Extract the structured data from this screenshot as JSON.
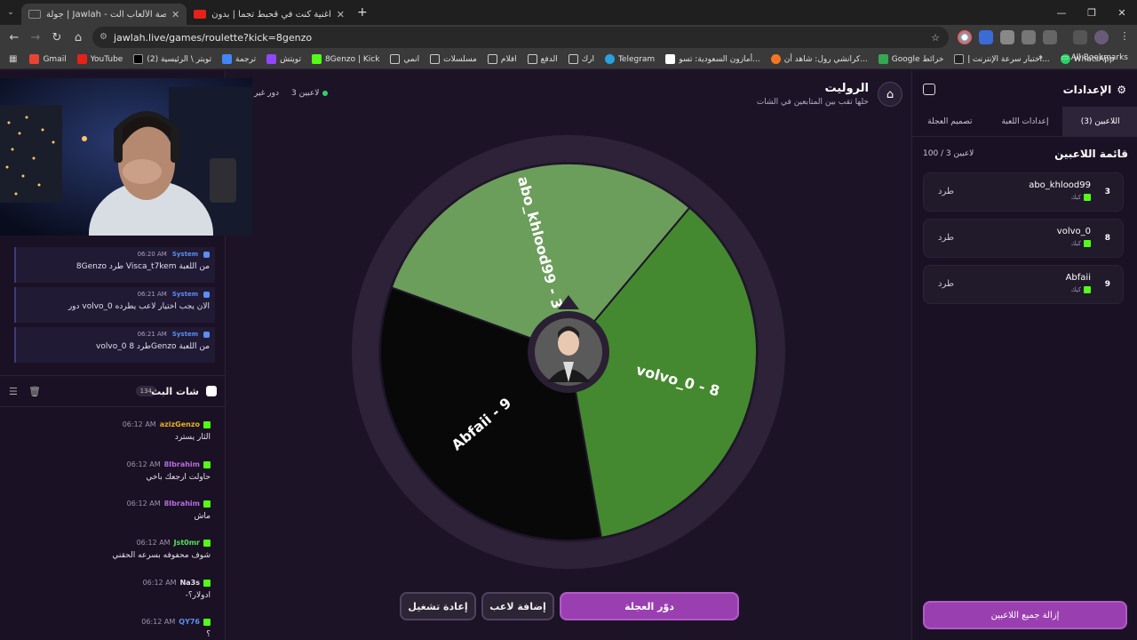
{
  "browser": {
    "tabs": [
      {
        "title": "جولة | Jawlah - منصة الألعاب الت",
        "active": true
      },
      {
        "title": "اغنية كنت في قحبط تجما | بدون",
        "active": false
      }
    ],
    "url": "jawlah.live/games/roulette?kick=8genzo",
    "bookmarks": [
      "Gmail",
      "YouTube",
      "(2) تويتر \\ الرئيسية",
      "ترجمة",
      "تويتش",
      "8Genzo | Kick",
      "انمي",
      "مسلسلات",
      "افلام",
      "الدفع",
      "ارك",
      "Telegram",
      "أمازون السعودية: تسو...",
      "كرانشي رول: شاهد أن...",
      "Google خرائط",
      "اختبار سرعة الإنترنت إ...",
      "WhatsApp"
    ],
    "all_bookmarks": "All Bookmarks"
  },
  "system_messages": [
    {
      "who": "System",
      "time": "06:20 AM",
      "text": "8Genzo طرد Visca_t7kem من اللعبة"
    },
    {
      "who": "System",
      "time": "06:21 AM",
      "text": "دور volvo_0 الان يجب اختيار لاعب يطرده"
    },
    {
      "who": "System",
      "time": "06:21 AM",
      "text": "volvo_0 طرد 8Genzo من اللعبة"
    }
  ],
  "chat": {
    "title": "شات البث",
    "count": "134",
    "messages": [
      {
        "user": "azizGenzo",
        "color": "#e8b020",
        "time": "06:12 AM",
        "text": "الثار يسترد"
      },
      {
        "user": "8Ibrahim",
        "color": "#b86be0",
        "time": "06:12 AM",
        "text": "حاولت ارجعك باخي"
      },
      {
        "user": "8Ibrahim",
        "color": "#b86be0",
        "time": "06:12 AM",
        "text": "ماش"
      },
      {
        "user": "Jst0mr",
        "color": "#53e05a",
        "time": "06:12 AM",
        "text": "شوف محفوفه بسرعه الحقني"
      },
      {
        "user": "Na3s",
        "color": "#e8e0ef",
        "time": "06:12 AM",
        "text": "-ادولار؟"
      },
      {
        "user": "QY76",
        "color": "#5b8ef0",
        "time": "06:12 AM",
        "text": "؟"
      }
    ]
  },
  "game": {
    "title": "الروليت",
    "subtitle": "خلها تقب بين المتابعين في الشات",
    "players_online": "3 لاعبين",
    "turn_label": "دور غير",
    "segments": [
      {
        "label": "volvo_0 - 8",
        "color": "#44892f",
        "start": 0.1111,
        "end": 0.4722
      },
      {
        "label": "Abfaii - 9",
        "color": "#080808",
        "start": 0.4722,
        "end": 0.8056
      },
      {
        "label": "abo_khlood99 - 3",
        "color": "#6b9e5a",
        "start": 0.8056,
        "end": 1.1111
      }
    ],
    "buttons": {
      "spin": "دوّر العجلة",
      "add": "إضافة لاعب",
      "restart": "إعادة تشغيل"
    }
  },
  "settings": {
    "title": "الإعدادات",
    "tabs": [
      "اللاعبين (3)",
      "إعدادات اللعبة",
      "تصميم العجلة"
    ],
    "list_title": "قائمة اللاعبين",
    "list_count": "100 / 3 لاعبين",
    "players": [
      {
        "num": "3",
        "name": "abo_khlood99",
        "platform": "كيك",
        "kick": "طرد"
      },
      {
        "num": "8",
        "name": "volvo_0",
        "platform": "كيك",
        "kick": "طرد"
      },
      {
        "num": "9",
        "name": "Abfaii",
        "platform": "كيك",
        "kick": "طرد"
      }
    ],
    "remove_all": "إزالة جميع اللاعبين"
  }
}
